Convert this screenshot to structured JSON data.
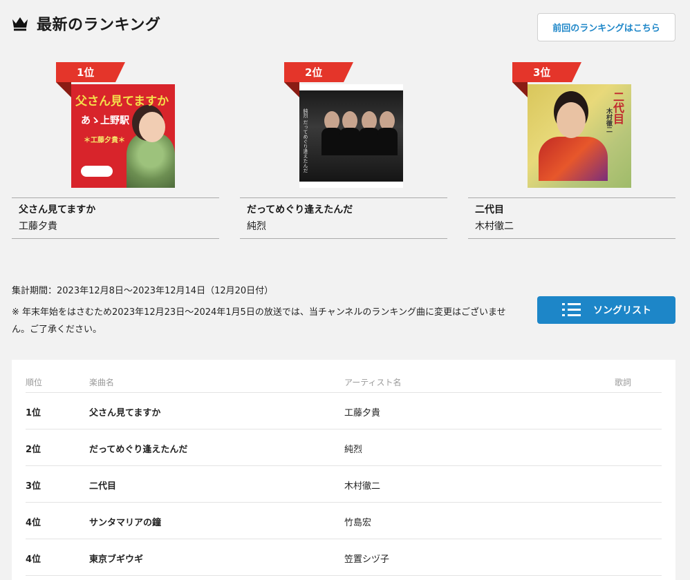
{
  "header": {
    "title": "最新のランキング",
    "prev_button": "前回のランキングはこちら"
  },
  "top3": [
    {
      "badge": "1位",
      "song": "父さん見てますか",
      "artist": "工藤夕貴",
      "cover_title": "父さん見てますか",
      "cover_subtitle": "あゝ上野駅",
      "cover_artist": "＊工藤夕貴＊"
    },
    {
      "badge": "2位",
      "song": "だってめぐり逢えたんだ",
      "artist": "純烈",
      "cover_text": "純烈 だってめぐり逢えたんだ"
    },
    {
      "badge": "3位",
      "song": "二代目",
      "artist": "木村徹二",
      "cover_title": "二代目",
      "cover_artist": "木村徹二"
    }
  ],
  "period": "集計期間：2023年12月8日〜2023年12月14日（12月20日付）",
  "note": "※ 年末年始をはさむため2023年12月23日〜2024年1月5日の放送では、当チャンネルのランキング曲に変更はございません。ご了承ください。",
  "songlist_button": "ソングリスト",
  "table": {
    "headers": {
      "rank": "順位",
      "song": "楽曲名",
      "artist": "アーティスト名",
      "lyrics": "歌詞"
    },
    "rows": [
      {
        "rank": "1位",
        "song": "父さん見てますか",
        "artist": "工藤夕貴"
      },
      {
        "rank": "2位",
        "song": "だってめぐり逢えたんだ",
        "artist": "純烈"
      },
      {
        "rank": "3位",
        "song": "二代目",
        "artist": "木村徹二"
      },
      {
        "rank": "4位",
        "song": "サンタマリアの鐘",
        "artist": "竹島宏"
      },
      {
        "rank": "4位",
        "song": "東京ブギウギ",
        "artist": "笠置シヅ子"
      }
    ]
  },
  "colors": {
    "accent_blue": "#1d86c8",
    "badge_red": "#e4352a",
    "background": "#f2f2f2"
  },
  "icons": {
    "title_icon": "crown-icon",
    "songlist_icon": "list-icon"
  }
}
